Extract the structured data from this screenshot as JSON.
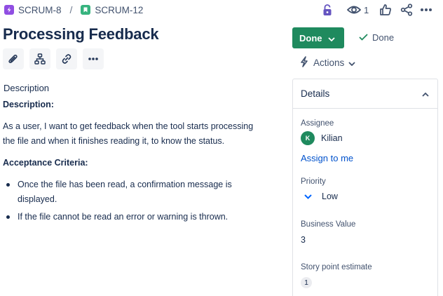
{
  "breadcrumb": {
    "parent_key": "SCRUM-8",
    "separator": "/",
    "issue_key": "SCRUM-12"
  },
  "header": {
    "watch_count": "1"
  },
  "issue": {
    "title": "Processing Feedback"
  },
  "status": {
    "button_label": "Done",
    "resolution_label": "Done",
    "actions_label": "Actions"
  },
  "description": {
    "section_label": "Description",
    "heading": "Description:",
    "body": "As a user, I want to get feedback when the tool starts processing the file and when it finishes reading it, to know the status.",
    "criteria_heading": "Acceptance Criteria:",
    "criteria": [
      "Once the file has been read, a confirmation message is displayed.",
      "If the file cannot be read an error or warning is thrown."
    ]
  },
  "details": {
    "title": "Details",
    "assignee_label": "Assignee",
    "assignee_initial": "K",
    "assignee_name": "Kilian",
    "assign_to_me": "Assign to me",
    "priority_label": "Priority",
    "priority_value": "Low",
    "business_value_label": "Business Value",
    "business_value": "3",
    "story_points_label": "Story point estimate",
    "story_points": "1"
  },
  "colors": {
    "done_green": "#1f8a5e",
    "link_blue": "#0052cc",
    "priority_low_blue": "#0065ff",
    "epic_purple": "#904ee2",
    "story_green": "#36b37e",
    "lock_blue": "#6554c0"
  },
  "icons": [
    "epic-icon",
    "story-icon",
    "lock-icon",
    "eye-icon",
    "like-icon",
    "share-icon",
    "more-icon",
    "attach-icon",
    "child-issue-icon",
    "link-icon",
    "chevron-down-icon",
    "check-icon",
    "lightning-icon",
    "chevron-up-icon",
    "priority-low-icon"
  ]
}
